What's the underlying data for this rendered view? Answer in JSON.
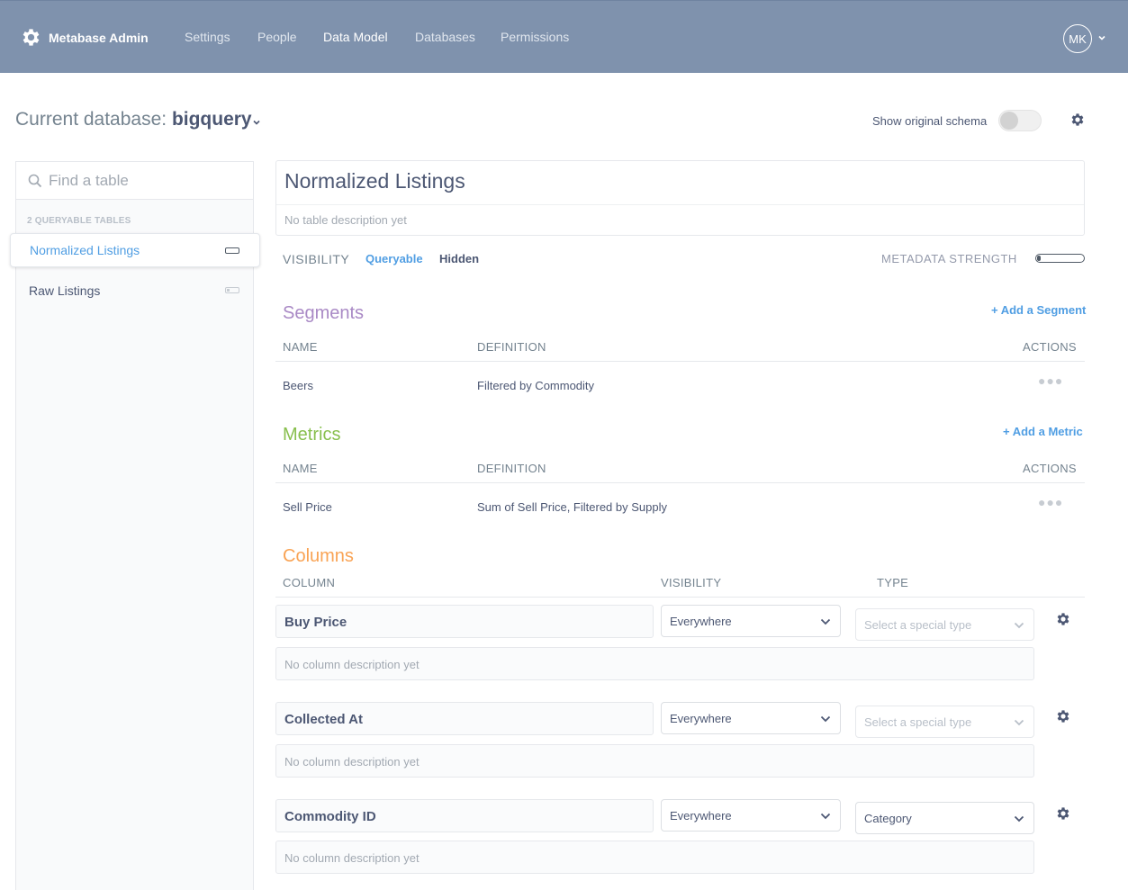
{
  "nav": {
    "brand": "Metabase Admin",
    "items": [
      {
        "label": "Settings",
        "active": false
      },
      {
        "label": "People",
        "active": false
      },
      {
        "label": "Data Model",
        "active": true
      },
      {
        "label": "Databases",
        "active": false
      },
      {
        "label": "Permissions",
        "active": false
      }
    ],
    "avatar_initials": "MK"
  },
  "header": {
    "db_prefix": "Current database: ",
    "db_name": "bigquery",
    "show_schema_label": "Show original schema",
    "show_schema_enabled": false
  },
  "sidebar": {
    "search_placeholder": "Find a table",
    "count_label": "2 QUERYABLE TABLES",
    "tables": [
      {
        "name": "Normalized Listings",
        "selected": true
      },
      {
        "name": "Raw Listings",
        "selected": false
      }
    ]
  },
  "table": {
    "name": "Normalized Listings",
    "description_placeholder": "No table description yet",
    "visibility_label": "VISIBILITY",
    "visibility_options": [
      "Queryable",
      "Hidden"
    ],
    "visibility_selected": "Queryable",
    "metadata_strength_label": "METADATA STRENGTH"
  },
  "segments": {
    "title": "Segments",
    "add_label": "+ Add a Segment",
    "headers": {
      "name": "NAME",
      "definition": "DEFINITION",
      "actions": "ACTIONS"
    },
    "rows": [
      {
        "name": "Beers",
        "definition": "Filtered by Commodity"
      }
    ]
  },
  "metrics": {
    "title": "Metrics",
    "add_label": "+ Add a Metric",
    "headers": {
      "name": "NAME",
      "definition": "DEFINITION",
      "actions": "ACTIONS"
    },
    "rows": [
      {
        "name": "Sell Price",
        "definition": "Sum of Sell Price, Filtered by Supply"
      }
    ]
  },
  "columns": {
    "title": "Columns",
    "headers": {
      "column": "COLUMN",
      "visibility": "VISIBILITY",
      "type": "TYPE"
    },
    "fields": [
      {
        "name": "Buy Price",
        "visibility": "Everywhere",
        "type": "Select a special type",
        "type_is_placeholder": true,
        "description_placeholder": "No column description yet"
      },
      {
        "name": "Collected At",
        "visibility": "Everywhere",
        "type": "Select a special type",
        "type_is_placeholder": true,
        "description_placeholder": "No column description yet"
      },
      {
        "name": "Commodity ID",
        "visibility": "Everywhere",
        "type": "Category",
        "type_is_placeholder": false,
        "description_placeholder": "No column description yet"
      }
    ]
  },
  "colors": {
    "nav_bg": "#7f92ad",
    "accent_blue": "#509ee3",
    "segments_purple": "#a989c5",
    "metrics_green": "#88bf4d",
    "columns_orange": "#f9a354",
    "text_dark": "#4c5773"
  },
  "icons": {
    "brand": "gear-icon",
    "search": "search-icon",
    "settings": "gear-icon",
    "field_settings": "gear-icon",
    "dropdown": "chevron-down-icon",
    "actions": "ellipsis-icon"
  }
}
